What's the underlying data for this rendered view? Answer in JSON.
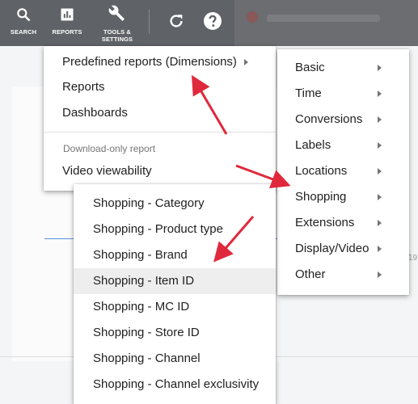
{
  "toolbar": {
    "search_label": "SEARCH",
    "reports_label": "REPORTS",
    "tools_label_line1": "TOOLS &",
    "tools_label_line2": "SETTINGS"
  },
  "main_menu": {
    "items": [
      {
        "label": "Predefined reports (Dimensions)",
        "has_submenu": true
      },
      {
        "label": "Reports"
      },
      {
        "label": "Dashboards"
      }
    ],
    "section_header": "Download-only report",
    "section_items": [
      {
        "label": "Video viewability"
      }
    ]
  },
  "dimensions_menu": {
    "items": [
      {
        "label": "Basic"
      },
      {
        "label": "Time"
      },
      {
        "label": "Conversions"
      },
      {
        "label": "Labels"
      },
      {
        "label": "Locations"
      },
      {
        "label": "Shopping"
      },
      {
        "label": "Extensions"
      },
      {
        "label": "Display/Video"
      },
      {
        "label": "Other"
      }
    ]
  },
  "shopping_menu": {
    "items": [
      {
        "label": "Shopping - Category"
      },
      {
        "label": "Shopping - Product type"
      },
      {
        "label": "Shopping - Brand"
      },
      {
        "label": "Shopping - Item ID",
        "highlighted": true
      },
      {
        "label": "Shopping - MC ID"
      },
      {
        "label": "Shopping - Store ID"
      },
      {
        "label": "Shopping - Channel"
      },
      {
        "label": "Shopping - Channel exclusivity"
      }
    ]
  },
  "background": {
    "fragment_right": "19"
  },
  "colors": {
    "toolbar": "#5f6266",
    "annotation_arrow": "#e0283c",
    "highlight": "#eeeeee"
  }
}
